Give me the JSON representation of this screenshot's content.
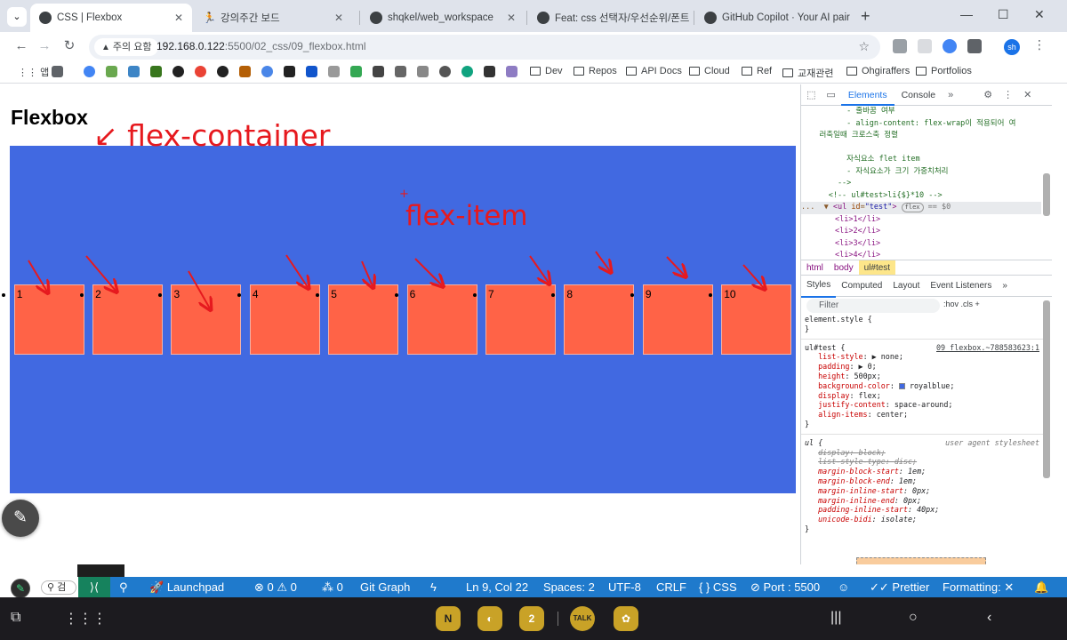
{
  "browser": {
    "tabs": [
      {
        "label": "CSS | Flexbox",
        "active": true
      },
      {
        "label": "강의주간 보드",
        "active": false
      },
      {
        "label": "shqkel/web_workspace",
        "active": false
      },
      {
        "label": "Feat: css 선택자/우선순위/폰트",
        "active": false
      },
      {
        "label": "GitHub Copilot · Your AI pair",
        "active": false
      }
    ],
    "new_tab_symbol": "+",
    "window_controls": [
      "—",
      "☐",
      "✕"
    ],
    "address": {
      "security_label": "주의 요함",
      "host": "192.168.0.122",
      "path": ":5500/02_css/09_flexbox.html"
    },
    "profile_initials": "sh",
    "bookmarks": {
      "apps_label": "앱",
      "folders": [
        "Dev",
        "Repos",
        "API Docs",
        "Cloud",
        "Ref",
        "교재관련",
        "Ohgiraffers",
        "Portfolios"
      ]
    }
  },
  "page": {
    "heading": "Flexbox",
    "items": [
      "1",
      "2",
      "3",
      "4",
      "5",
      "6",
      "7",
      "8",
      "9",
      "10"
    ],
    "annotations": {
      "container": "↙ flex-container",
      "item": "flex-item",
      "plus": "+"
    },
    "colors": {
      "container": "#4169e1",
      "item": "#ff6347",
      "annotation": "#e6191e"
    }
  },
  "devtools": {
    "tabs": [
      "Elements",
      "Console"
    ],
    "active_tab": "Elements",
    "code_lines": [
      "          - 줄바꿈 여부",
      "          - align-content: flex-wrap이 적용되어 여",
      "    러축일때 크로스축 정렬",
      "",
      "          자식요소 flet item",
      "          - 자식요소가 크기 가중치처리",
      "        -->",
      "      <!-- ul#test>li{$}*10 -->"
    ],
    "selected_line": {
      "tag_open": "<ul",
      "attr": "id",
      "value": "\"test\"",
      "badge": "flex",
      "suffix": "== $0"
    },
    "child_lines": [
      "<li>1</li>",
      "<li>2</li>",
      "<li>3</li>",
      "<li>4</li>"
    ],
    "breadcrumbs": [
      "html",
      "body",
      "ul#test"
    ],
    "subtabs": [
      "Styles",
      "Computed",
      "Layout",
      "Event Listeners"
    ],
    "filter_placeholder": "Filter",
    "filter_tools": ":hov .cls +",
    "styles": {
      "element_style": "element.style {",
      "rule1_selector": "ul#test {",
      "rule1_source": "09_flexbox.~788583623:1",
      "rule1_props": [
        {
          "prop": "list-style",
          "value": "▶ none;"
        },
        {
          "prop": "padding",
          "value": "▶ 0;"
        },
        {
          "prop": "height",
          "value": "500px;"
        },
        {
          "prop": "background-color",
          "value": "royalblue;"
        },
        {
          "prop": "display",
          "value": "flex;"
        },
        {
          "prop": "justify-content",
          "value": "space-around;"
        },
        {
          "prop": "align-items",
          "value": "center;"
        }
      ],
      "rule2_selector": "ul {",
      "rule2_source": "user agent stylesheet",
      "rule2_props": [
        {
          "prop": "display",
          "value": "block;",
          "struck": true
        },
        {
          "prop": "list-style-type",
          "value": "disc;",
          "struck": true
        },
        {
          "prop": "margin-block-start",
          "value": "1em;",
          "struck": false
        },
        {
          "prop": "margin-block-end",
          "value": "1em;",
          "struck": false
        },
        {
          "prop": "margin-inline-start",
          "value": "0px;",
          "struck": false
        },
        {
          "prop": "margin-inline-end",
          "value": "0px;",
          "struck": false
        },
        {
          "prop": "padding-inline-start",
          "value": "40px;",
          "struck": false
        },
        {
          "prop": "unicode-bidi",
          "value": "isolate;",
          "struck": false
        }
      ]
    }
  },
  "statusbar": {
    "search_label": "검",
    "launchpad": "Launchpad",
    "problems": "⊗ 0 ⚠ 0",
    "ports": "0",
    "git_graph": "Git Graph",
    "position": "Ln 9, Col 22",
    "spaces": "Spaces: 2",
    "encoding": "UTF-8",
    "eol": "CRLF",
    "language": "CSS",
    "port": "Port : 5500",
    "prettier": "Prettier",
    "formatting": "Formatting: ✕"
  }
}
